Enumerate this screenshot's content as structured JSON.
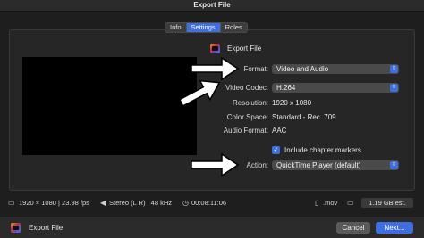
{
  "window": {
    "title": "Export File"
  },
  "tabs": [
    {
      "label": "Info",
      "active": false
    },
    {
      "label": "Settings",
      "active": true
    },
    {
      "label": "Roles",
      "active": false
    }
  ],
  "settings": {
    "export_label": "Export File",
    "format_label": "Format:",
    "format_value": "Video and Audio",
    "video_codec_label": "Video Codec:",
    "video_codec_value": "H.264",
    "resolution_label": "Resolution:",
    "resolution_value": "1920 x 1080",
    "color_space_label": "Color Space:",
    "color_space_value": "Standard - Rec. 709",
    "audio_format_label": "Audio Format:",
    "audio_format_value": "AAC",
    "chapter_markers_label": "Include chapter markers",
    "chapter_markers_checked": true,
    "action_label": "Action:",
    "action_value": "QuickTime Player (default)"
  },
  "status": {
    "video_info": "1920 × 1080 | 23.98 fps",
    "audio_info": "Stereo (L R) | 48 kHz",
    "duration": "00:08:11:06",
    "extension": ".mov",
    "file_size": "1.19 GB est."
  },
  "footer": {
    "label": "Export File",
    "cancel_label": "Cancel",
    "next_label": "Next..."
  },
  "colors": {
    "accent": "#3f6ee0",
    "background": "#1e1e1e",
    "panel": "#262626"
  },
  "icons": [
    "final-cut-pro-icon",
    "film-icon",
    "speaker-icon",
    "clock-icon",
    "document-icon",
    "monitor-icon",
    "checkmark-icon",
    "chevron-updown-icon",
    "arrow-annotation"
  ]
}
